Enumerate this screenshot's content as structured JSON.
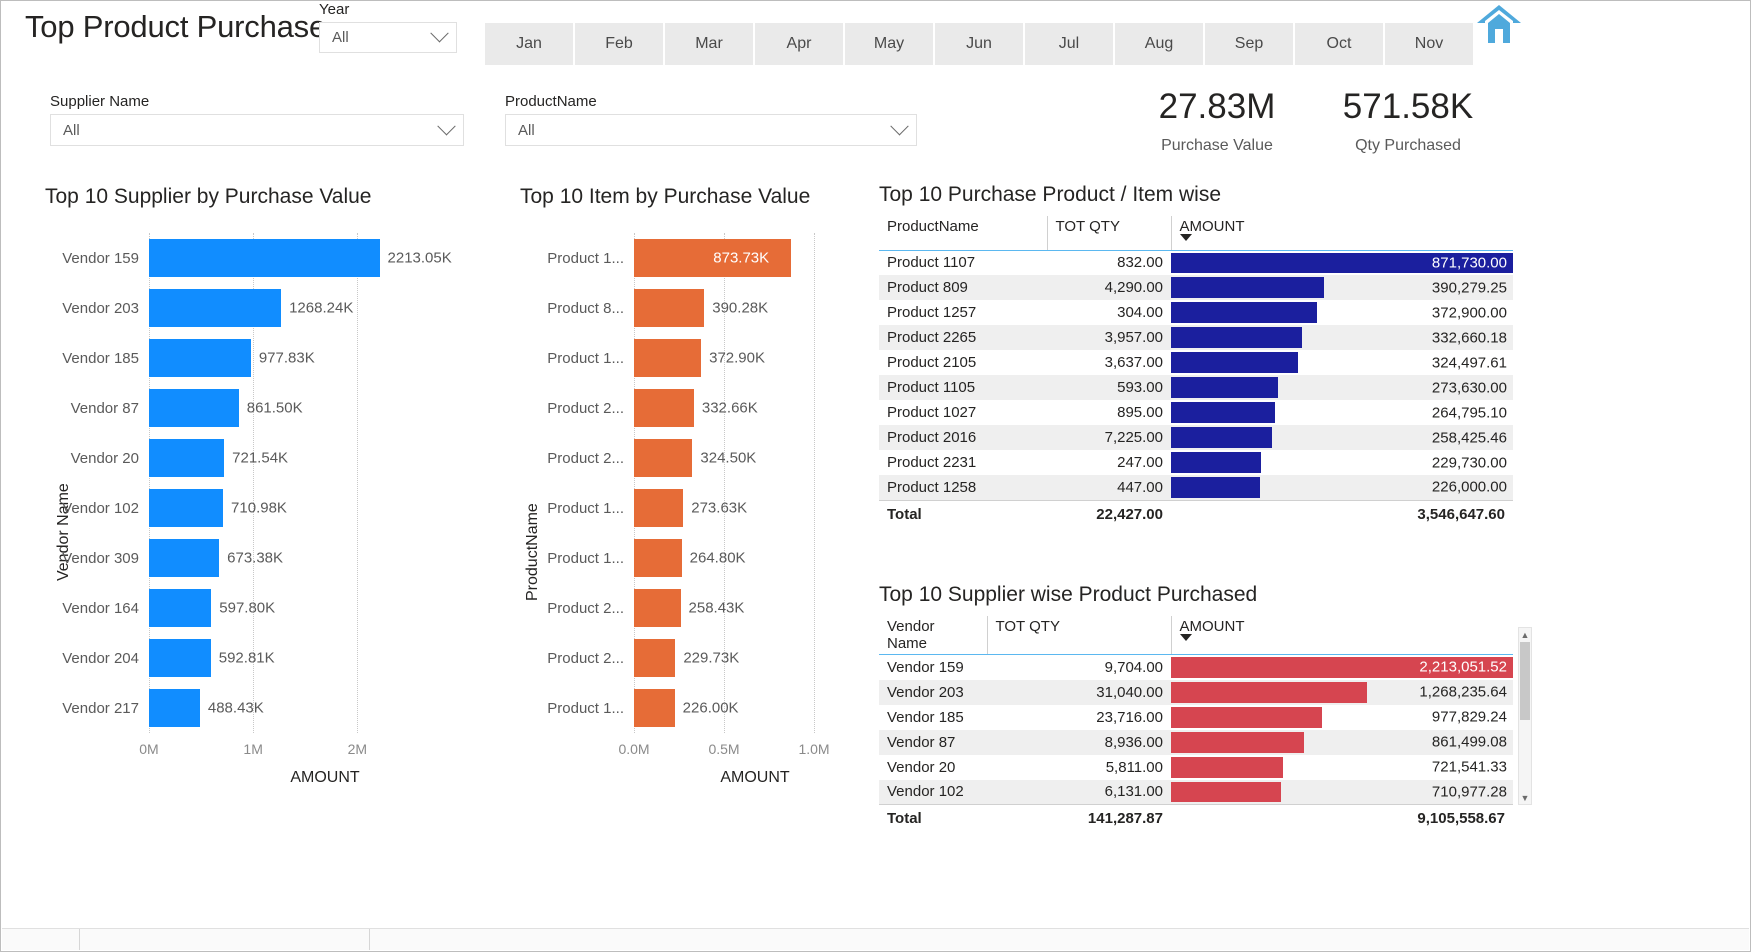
{
  "report": {
    "title": "Top Product Purchase",
    "home_icon": "home-icon"
  },
  "slicers": {
    "year": {
      "label": "Year",
      "value": "All"
    },
    "supplier": {
      "label": "Supplier Name",
      "value": "All"
    },
    "product": {
      "label": "ProductName",
      "value": "All"
    }
  },
  "months": [
    "Jan",
    "Feb",
    "Mar",
    "Apr",
    "May",
    "Jun",
    "Jul",
    "Aug",
    "Sep",
    "Oct",
    "Nov"
  ],
  "kpis": [
    {
      "value": "27.83M",
      "label": "Purchase Value"
    },
    {
      "value": "571.58K",
      "label": "Qty Purchased"
    }
  ],
  "chart_data": [
    {
      "id": "supplier_bar",
      "type": "bar",
      "orientation": "horizontal",
      "title": "Top 10 Supplier by Purchase Value",
      "xlabel": "AMOUNT",
      "ylabel": "Vendor Name",
      "xlim": [
        0,
        2400000
      ],
      "xticks": [
        0,
        1000000,
        2000000
      ],
      "xticklabels": [
        "0M",
        "1M",
        "2M"
      ],
      "grid": true,
      "color": "#118DFF",
      "categories": [
        "Vendor 159",
        "Vendor 203",
        "Vendor 185",
        "Vendor 87",
        "Vendor 20",
        "Vendor 102",
        "Vendor 309",
        "Vendor 164",
        "Vendor 204",
        "Vendor 217"
      ],
      "values": [
        2213050,
        1268240,
        977830,
        861500,
        721540,
        710980,
        673380,
        597800,
        592810,
        488430
      ],
      "datalabels": [
        "2213.05K",
        "1268.24K",
        "977.83K",
        "861.50K",
        "721.54K",
        "710.98K",
        "673.38K",
        "597.80K",
        "592.81K",
        "488.43K"
      ]
    },
    {
      "id": "item_bar",
      "type": "bar",
      "orientation": "horizontal",
      "title": "Top 10 Item by Purchase Value",
      "xlabel": "AMOUNT",
      "ylabel": "ProductName",
      "xlim": [
        0,
        1000000
      ],
      "xticks": [
        0,
        500000,
        1000000
      ],
      "xticklabels": [
        "0.0M",
        "0.5M",
        "1.0M"
      ],
      "grid": true,
      "color": "#E66C37",
      "categories": [
        "Product 1...",
        "Product 8...",
        "Product 1...",
        "Product 2...",
        "Product 2...",
        "Product 1...",
        "Product 1...",
        "Product 2...",
        "Product 2...",
        "Product 1..."
      ],
      "values": [
        873730,
        390280,
        372900,
        332660,
        324500,
        273630,
        264800,
        258430,
        229730,
        226000
      ],
      "datalabels": [
        "873.73K",
        "390.28K",
        "372.90K",
        "332.66K",
        "324.50K",
        "273.63K",
        "264.80K",
        "258.43K",
        "229.73K",
        "226.00K"
      ],
      "label_inside_first": true
    },
    {
      "id": "product_table",
      "type": "table",
      "title": "Top 10 Purchase Product / Item wise",
      "columns": [
        "ProductName",
        "TOT QTY",
        "AMOUNT"
      ],
      "sorted_by": "AMOUNT",
      "bar_color": "#1B1F9E",
      "max_amount": 871730,
      "rows": [
        {
          "name": "Product 1107",
          "qty": "832.00",
          "amount": "871,730.00",
          "amount_value": 871730.0
        },
        {
          "name": "Product 809",
          "qty": "4,290.00",
          "amount": "390,279.25",
          "amount_value": 390279.25
        },
        {
          "name": "Product 1257",
          "qty": "304.00",
          "amount": "372,900.00",
          "amount_value": 372900.0
        },
        {
          "name": "Product 2265",
          "qty": "3,957.00",
          "amount": "332,660.18",
          "amount_value": 332660.18
        },
        {
          "name": "Product 2105",
          "qty": "3,637.00",
          "amount": "324,497.61",
          "amount_value": 324497.61
        },
        {
          "name": "Product 1105",
          "qty": "593.00",
          "amount": "273,630.00",
          "amount_value": 273630.0
        },
        {
          "name": "Product 1027",
          "qty": "895.00",
          "amount": "264,795.10",
          "amount_value": 264795.1
        },
        {
          "name": "Product 2016",
          "qty": "7,225.00",
          "amount": "258,425.46",
          "amount_value": 258425.46
        },
        {
          "name": "Product 2231",
          "qty": "247.00",
          "amount": "229,730.00",
          "amount_value": 229730.0
        },
        {
          "name": "Product 1258",
          "qty": "447.00",
          "amount": "226,000.00",
          "amount_value": 226000.0
        }
      ],
      "total": {
        "label": "Total",
        "qty": "22,427.00",
        "amount": "3,546,647.60"
      }
    },
    {
      "id": "supplier_table",
      "type": "table",
      "title": "Top 10 Supplier wise Product Purchased",
      "columns": [
        "Vendor Name",
        "TOT QTY",
        "AMOUNT"
      ],
      "sorted_by": "AMOUNT",
      "bar_color": "#D64550",
      "max_amount": 2213051.52,
      "rows": [
        {
          "name": "Vendor 159",
          "qty": "9,704.00",
          "amount": "2,213,051.52",
          "amount_value": 2213051.52
        },
        {
          "name": "Vendor 203",
          "qty": "31,040.00",
          "amount": "1,268,235.64",
          "amount_value": 1268235.64
        },
        {
          "name": "Vendor 185",
          "qty": "23,716.00",
          "amount": "977,829.24",
          "amount_value": 977829.24
        },
        {
          "name": "Vendor 87",
          "qty": "8,936.00",
          "amount": "861,499.08",
          "amount_value": 861499.08
        },
        {
          "name": "Vendor 20",
          "qty": "5,811.00",
          "amount": "721,541.33",
          "amount_value": 721541.33
        },
        {
          "name": "Vendor 102",
          "qty": "6,131.00",
          "amount": "710,977.28",
          "amount_value": 710977.28
        }
      ],
      "total": {
        "label": "Total",
        "qty": "141,287.87",
        "amount": "9,105,558.67"
      }
    }
  ]
}
